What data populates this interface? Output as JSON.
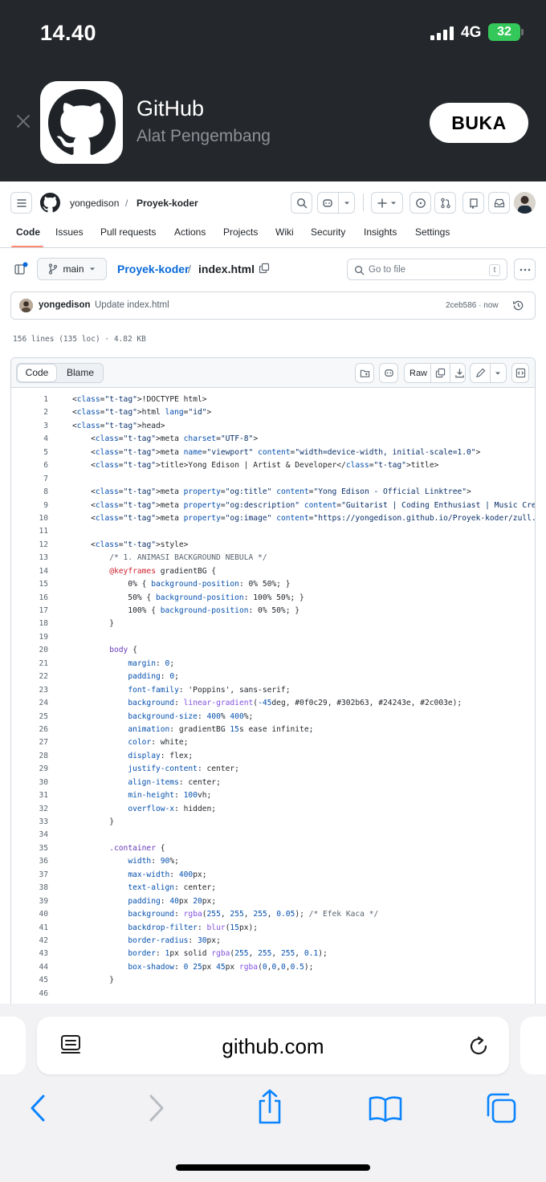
{
  "status_bar": {
    "time": "14.40",
    "network": "4G",
    "battery": "32"
  },
  "app_banner": {
    "name": "GitHub",
    "subtitle": "Alat Pengembang",
    "open_label": "BUKA"
  },
  "github": {
    "owner": "yongedison",
    "separator": "/",
    "repo": "Proyek-koder",
    "tabs": [
      "Code",
      "Issues",
      "Pull requests",
      "Actions",
      "Projects",
      "Wiki",
      "Security",
      "Insights",
      "Settings"
    ],
    "active_tab": "Code",
    "branch": "main",
    "file_name": "index.html",
    "goto_placeholder": "Go to file",
    "goto_shortcut": "t",
    "commit": {
      "author": "yongedison",
      "message": "Update index.html",
      "meta": "2ceb586 · now"
    },
    "file_stats": "156 lines (135 loc) · 4.82 KB",
    "code_tabs": {
      "code": "Code",
      "blame": "Blame"
    },
    "raw_label": "Raw",
    "code_lines": [
      "<!DOCTYPE html>",
      "<html lang=\"id\">",
      "<head>",
      "    <meta charset=\"UTF-8\">",
      "    <meta name=\"viewport\" content=\"width=device-width, initial-scale=1.0\">",
      "    <title>Yong Edison | Artist & Developer</title>",
      "",
      "    <meta property=\"og:title\" content=\"Yong Edison - Official Linktree\">",
      "    <meta property=\"og:description\" content=\"Guitarist | Coding Enthusiast | Music Creator\">",
      "    <meta property=\"og:image\" content=\"https://yongedison.github.io/Proyek-koder/zull.jpg\">",
      "",
      "    <style>",
      "        /* 1. ANIMASI BACKGROUND NEBULA */",
      "        @keyframes gradientBG {",
      "            0% { background-position: 0% 50%; }",
      "            50% { background-position: 100% 50%; }",
      "            100% { background-position: 0% 50%; }",
      "        }",
      "",
      "        body {",
      "            margin: 0;",
      "            padding: 0;",
      "            font-family: 'Poppins', sans-serif;",
      "            background: linear-gradient(-45deg, #0f0c29, #302b63, #24243e, #2c003e);",
      "            background-size: 400% 400%;",
      "            animation: gradientBG 15s ease infinite;",
      "            color: white;",
      "            display: flex;",
      "            justify-content: center;",
      "            align-items: center;",
      "            min-height: 100vh;",
      "            overflow-x: hidden;",
      "        }",
      "",
      "        .container {",
      "            width: 90%;",
      "            max-width: 400px;",
      "            text-align: center;",
      "            padding: 40px 20px;",
      "            background: rgba(255, 255, 255, 0.05); /* Efek Kaca */",
      "            backdrop-filter: blur(15px);",
      "            border-radius: 30px;",
      "            border: 1px solid rgba(255, 255, 255, 0.1);",
      "            box-shadow: 0 25px 45px rgba(0,0,0,0.5);",
      "        }",
      ""
    ]
  },
  "safari": {
    "url": "github.com"
  }
}
